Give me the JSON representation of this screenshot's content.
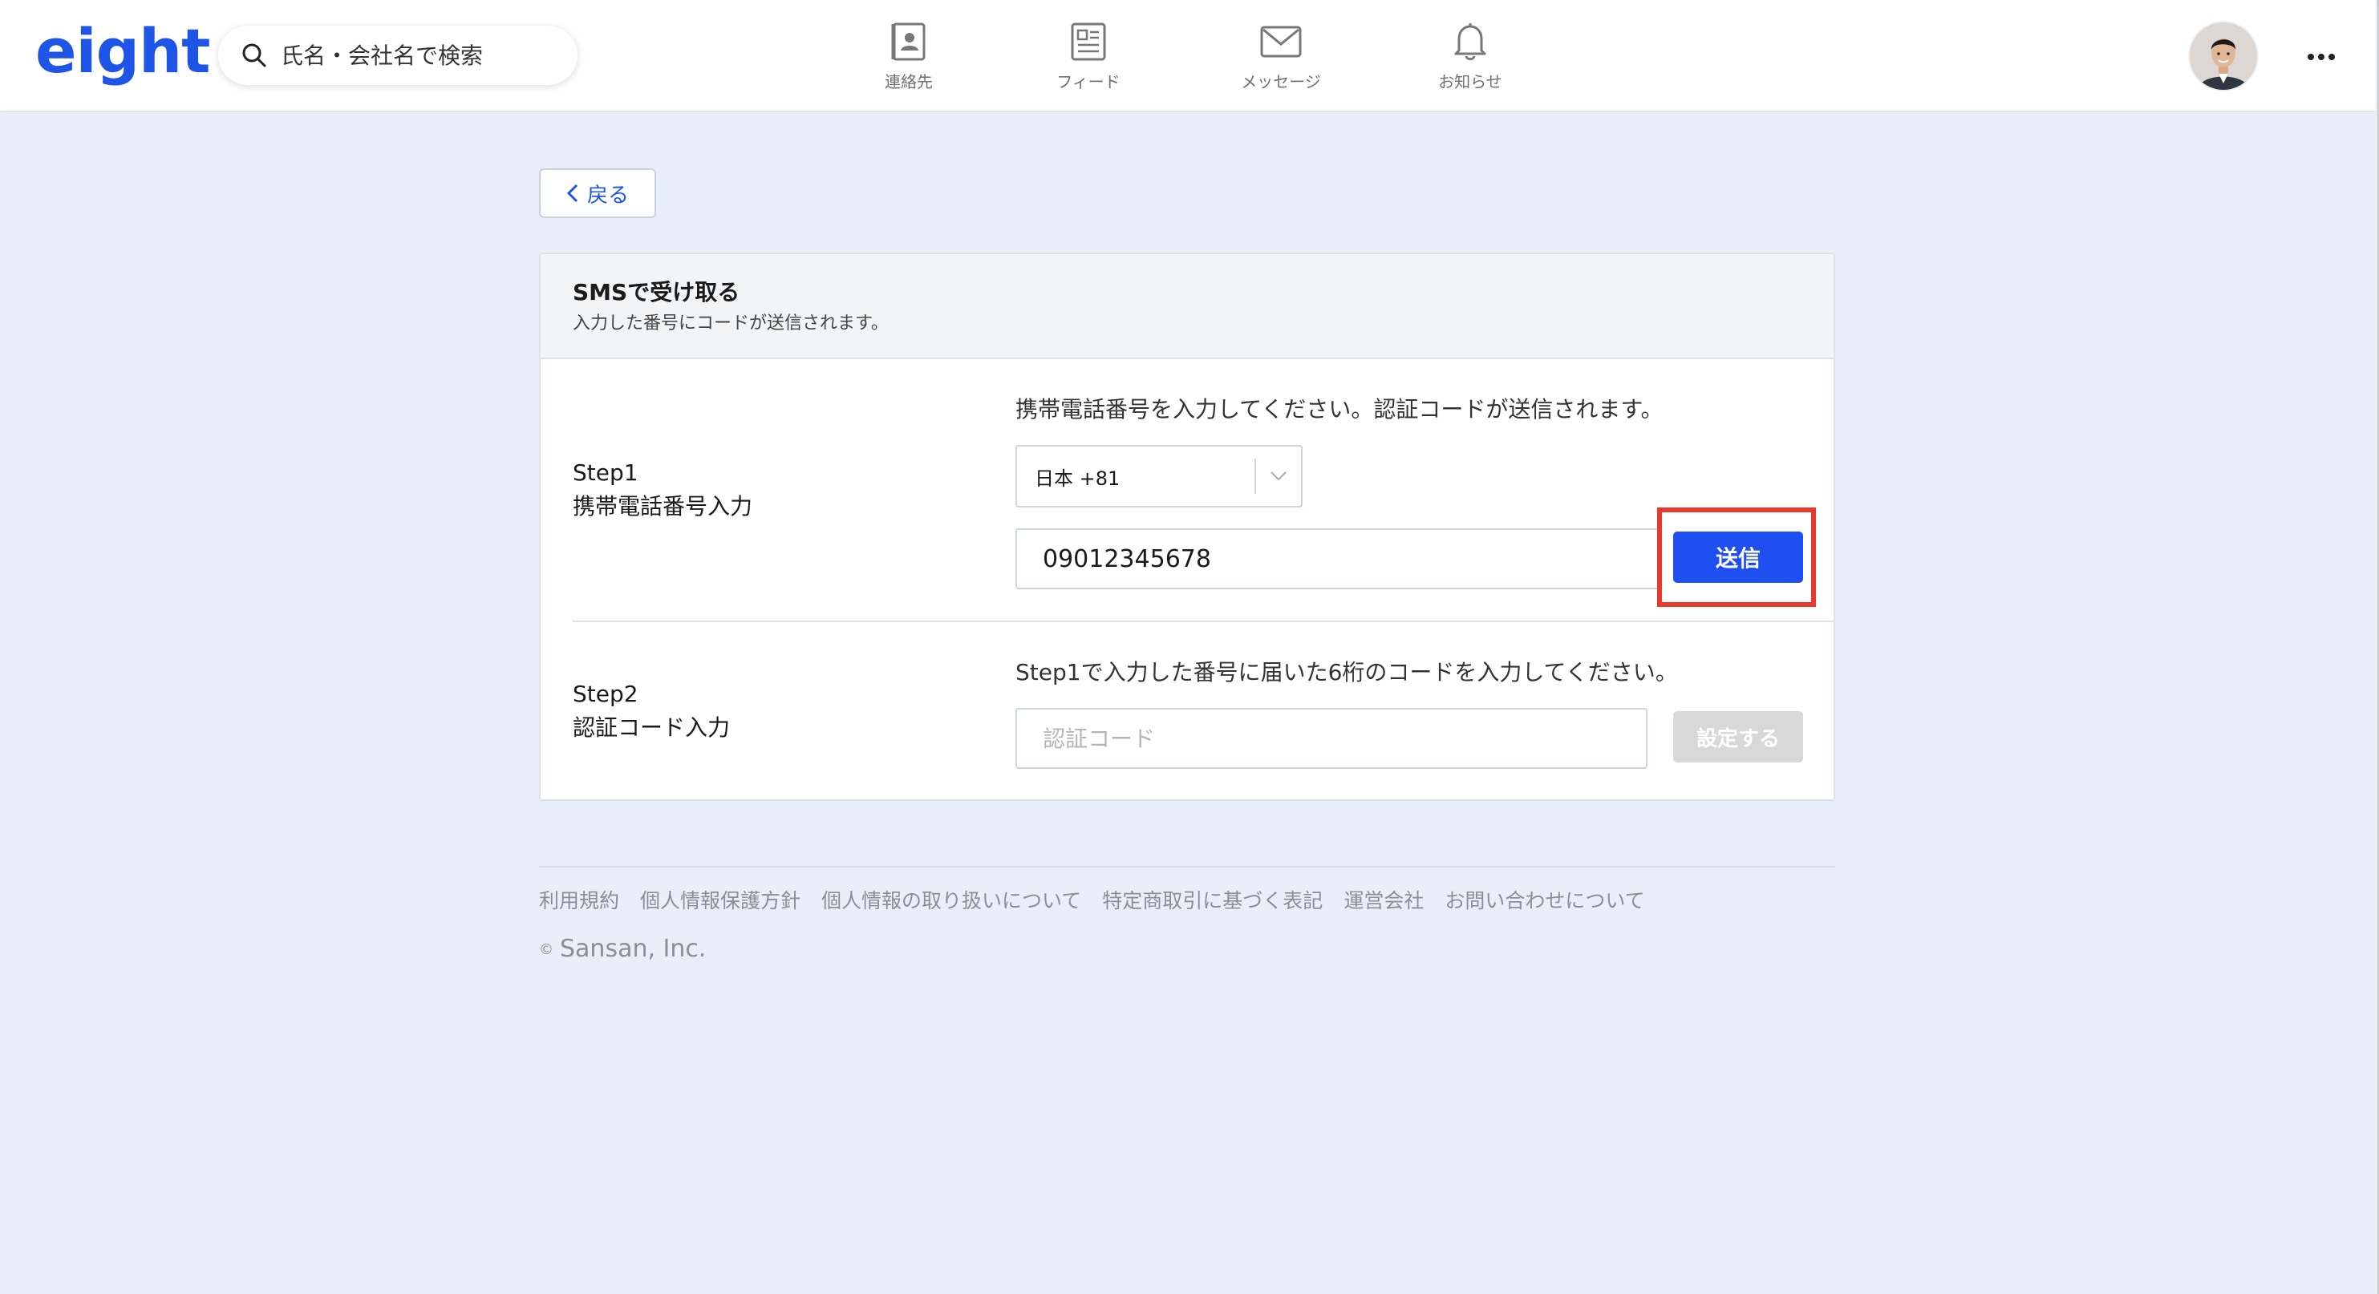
{
  "header": {
    "logo_text": "eight",
    "search": {
      "placeholder": "氏名・会社名で検索"
    },
    "nav": [
      {
        "label": "連絡先",
        "icon": "contacts-icon"
      },
      {
        "label": "フィード",
        "icon": "feed-icon"
      },
      {
        "label": "メッセージ",
        "icon": "message-icon"
      },
      {
        "label": "お知らせ",
        "icon": "bell-icon"
      }
    ],
    "more_icon": "more-horizontal-icon"
  },
  "back_button": {
    "label": "戻る",
    "icon": "chevron-left-icon"
  },
  "card": {
    "title": "SMSで受け取る",
    "subtitle": "入力した番号にコードが送信されます。",
    "step1": {
      "label_line1": "Step1",
      "label_line2": "携帯電話番号入力",
      "instruction": "携帯電話番号を入力してください。認証コードが送信されます。",
      "country_selected": "日本 +81",
      "phone_value": "09012345678",
      "send_label": "送信"
    },
    "step2": {
      "label_line1": "Step2",
      "label_line2": "認証コード入力",
      "instruction": "Step1で入力した番号に届いた6桁のコードを入力してください。",
      "code_placeholder": "認証コード",
      "set_label": "設定する"
    }
  },
  "footer": {
    "links": [
      "利用規約",
      "個人情報保護方針",
      "個人情報の取り扱いについて",
      "特定商取引に基づく表記",
      "運営会社",
      "お問い合わせについて"
    ],
    "copyright": "Sansan, Inc."
  },
  "colors": {
    "brand": "#1e55e6",
    "primary_button": "#1f4ff0",
    "highlight": "#e8392b",
    "background": "#e9eff9",
    "disabled_button": "#d8d8d8"
  }
}
